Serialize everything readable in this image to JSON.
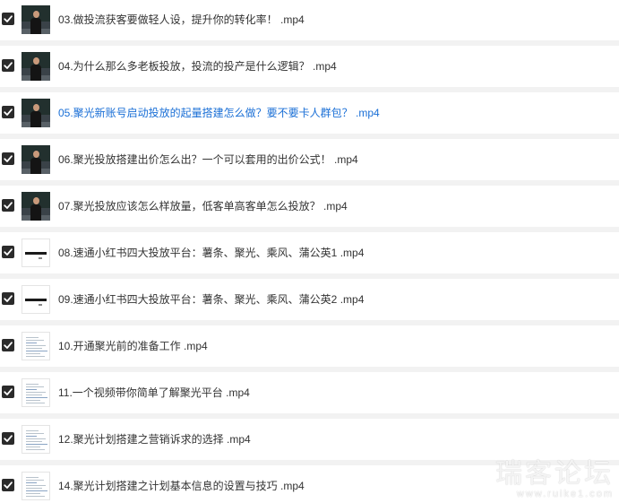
{
  "items": [
    {
      "label": "03.做投流获客要做轻人设，提升你的转化率！ .mp4",
      "thumb": "video-thumbnail",
      "active": false
    },
    {
      "label": "04.为什么那么多老板投放，投流的投产是什么逻辑？ .mp4",
      "thumb": "video-thumbnail",
      "active": false
    },
    {
      "label": "05.聚光新账号启动投放的起量搭建怎么做？要不要卡人群包？ .mp4",
      "thumb": "video-thumbnail",
      "active": true
    },
    {
      "label": "06.聚光投放搭建出价怎么出？一个可以套用的出价公式！ .mp4",
      "thumb": "video-thumbnail",
      "active": false
    },
    {
      "label": "07.聚光投放应该怎么样放量，低客单高客单怎么投放？ .mp4",
      "thumb": "video-thumbnail",
      "active": false
    },
    {
      "label": "08.速通小红书四大投放平台：薯条、聚光、乘风、蒲公英1 .mp4",
      "thumb": "slide-thumbnail",
      "active": false
    },
    {
      "label": "09.速通小红书四大投放平台：薯条、聚光、乘风、蒲公英2 .mp4",
      "thumb": "slide-thumbnail",
      "active": false
    },
    {
      "label": "10.开通聚光前的准备工作 .mp4",
      "thumb": "document-thumbnail",
      "active": false
    },
    {
      "label": "11.一个视频带你简单了解聚光平台 .mp4",
      "thumb": "document-thumbnail",
      "active": false
    },
    {
      "label": "12.聚光计划搭建之营销诉求的选择 .mp4",
      "thumb": "document-thumbnail",
      "active": false
    },
    {
      "label": "14.聚光计划搭建之计划基本信息的设置与技巧 .mp4",
      "thumb": "document-thumbnail",
      "active": false
    }
  ],
  "watermark": {
    "title": "瑞客论坛",
    "url": "www.ruike1.com"
  },
  "colors": {
    "active_text": "#1a6fd6",
    "text": "#333333",
    "checkbox": "#2b2b2b",
    "background": "#f2f2f2"
  }
}
